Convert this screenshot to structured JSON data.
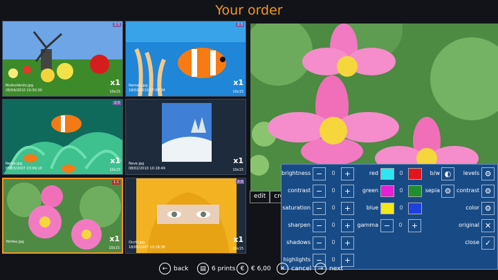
{
  "page_title": "Your order",
  "thumbnails": [
    {
      "file": "MulinoVento.jpg",
      "date": "26/04/2010 10:50:30",
      "qty": "x1",
      "size": "10x15",
      "ratio": "2:3"
    },
    {
      "file": "Nemo2.jpg",
      "date": "18/02/2010 17:07:34",
      "qty": "x1",
      "size": "10x15",
      "ratio": "2:3"
    },
    {
      "file": "Nemo.jpg",
      "date": "05/03/2007 23:09:10",
      "qty": "x1",
      "size": "10x15",
      "ratio": "2:3"
    },
    {
      "file": "Neve.jpg",
      "date": "08/02/2010 10:18:49",
      "qty": "x1",
      "size": "10x15",
      "ratio": ""
    },
    {
      "file": "Ninfee.jpg",
      "date": "",
      "qty": "x1",
      "size": "10x15",
      "ratio": "1:1"
    },
    {
      "file": "Occhi.jpg",
      "date": "18/05/2007 13:18:38",
      "qty": "x1",
      "size": "10x15",
      "ratio": "2:3"
    }
  ],
  "editbar": {
    "edit": "edit",
    "crop": "cro"
  },
  "adjust": {
    "brightness": {
      "label": "brightness",
      "value": "0"
    },
    "contrast": {
      "label": "contrast",
      "value": "0"
    },
    "saturation": {
      "label": "saturation",
      "value": "0"
    },
    "sharpen": {
      "label": "sharpen",
      "value": "0"
    },
    "shadows": {
      "label": "shadows",
      "value": "0"
    },
    "highlights": {
      "label": "highlights",
      "value": "0"
    }
  },
  "color_balance": {
    "red": {
      "label": "red",
      "value": "0",
      "light": "#2ee6f2",
      "dark": "#e3141c"
    },
    "green": {
      "label": "green",
      "value": "0",
      "light": "#e81fd6",
      "dark": "#1f8f2c"
    },
    "blue": {
      "label": "blue",
      "value": "0",
      "light": "#f2e81b",
      "dark": "#1f3fe0"
    },
    "gamma": {
      "label": "gamma",
      "value": "0"
    }
  },
  "effects": {
    "bw": "b/w",
    "sepia": "sepia"
  },
  "auto": {
    "levels": "levels",
    "contrast": "contrast",
    "color": "color",
    "original": "original",
    "close": "close"
  },
  "bottom": {
    "back": "back",
    "prints": "6 prints",
    "price": "€ 6,00",
    "cancel": "cancel",
    "next": "next"
  },
  "colors": {
    "accent": "#f39a1e",
    "panel": "#184b86",
    "background": "#111319"
  }
}
